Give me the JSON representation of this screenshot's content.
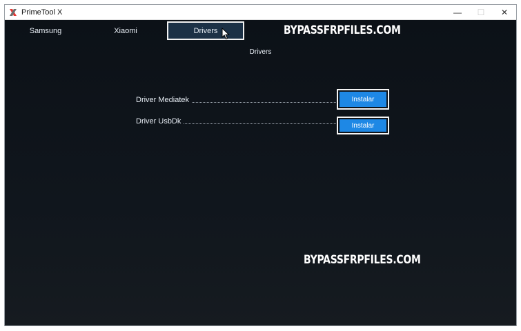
{
  "window": {
    "title": "PrimeTool X",
    "controls": {
      "minimize": "—",
      "maximize": "☐",
      "close": "✕"
    }
  },
  "tabs": [
    {
      "label": "Samsung",
      "active": false
    },
    {
      "label": "Xiaomi",
      "active": false
    },
    {
      "label": "Drivers",
      "active": true
    }
  ],
  "watermark": {
    "text": "BYPASSFRPFILES.COM"
  },
  "drivers_panel": {
    "title": "Drivers",
    "items": [
      {
        "label": "Driver Mediatek",
        "button": "Instalar"
      },
      {
        "label": "Driver UsbDk",
        "button": "Instalar"
      }
    ]
  },
  "colors": {
    "background": "#0e1319",
    "active_tab": "#1c3146",
    "button": "#1e88e5",
    "logo_red": "#e53935"
  }
}
